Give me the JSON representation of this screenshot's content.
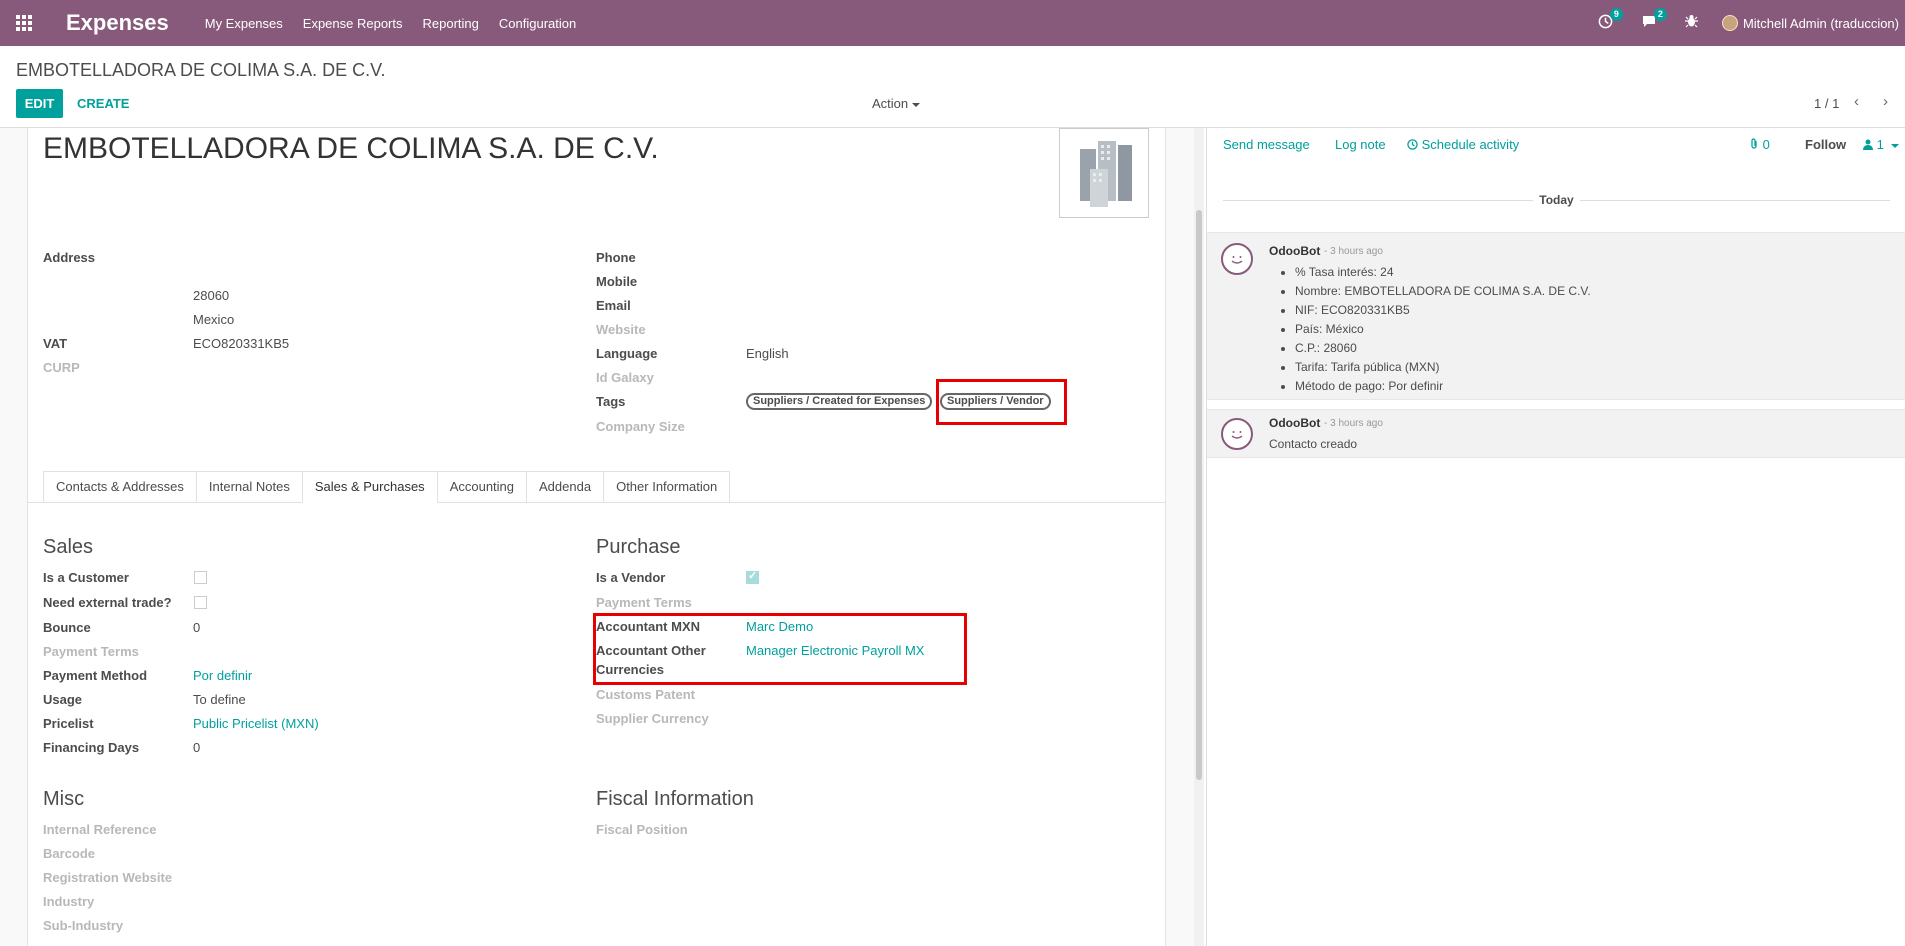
{
  "navbar": {
    "brand": "Expenses",
    "menu": [
      "My Expenses",
      "Expense Reports",
      "Reporting",
      "Configuration"
    ],
    "activity_count": "9",
    "messages_count": "2",
    "user": "Mitchell Admin (traduccion)"
  },
  "control_panel": {
    "breadcrumb": "EMBOTELLADORA DE COLIMA S.A. DE C.V.",
    "edit_label": "EDIT",
    "create_label": "CREATE",
    "action_label": "Action",
    "pager": "1 / 1"
  },
  "form": {
    "name": "EMBOTELLADORA DE COLIMA S.A. DE C.V.",
    "left": {
      "address_label": "Address",
      "zip": "28060",
      "country": "Mexico",
      "vat_label": "VAT",
      "vat": "ECO820331KB5",
      "curp_label": "CURP"
    },
    "right": {
      "phone_label": "Phone",
      "mobile_label": "Mobile",
      "email_label": "Email",
      "website_label": "Website",
      "language_label": "Language",
      "language": "English",
      "id_galaxy_label": "Id Galaxy",
      "tags_label": "Tags",
      "tags": [
        "Suppliers / Created for Expenses",
        "Suppliers / Vendor"
      ],
      "company_size_label": "Company Size"
    },
    "tabs": [
      "Contacts & Addresses",
      "Internal Notes",
      "Sales & Purchases",
      "Accounting",
      "Addenda",
      "Other Information"
    ],
    "active_tab": "Sales & Purchases",
    "sales": {
      "title": "Sales",
      "is_customer_label": "Is a Customer",
      "is_customer": false,
      "external_trade_label": "Need external trade?",
      "external_trade": false,
      "bounce_label": "Bounce",
      "bounce": "0",
      "payment_terms_label": "Payment Terms",
      "payment_method_label": "Payment Method",
      "payment_method": "Por definir",
      "usage_label": "Usage",
      "usage": "To define",
      "pricelist_label": "Pricelist",
      "pricelist": "Public Pricelist (MXN)",
      "financing_days_label": "Financing Days",
      "financing_days": "0"
    },
    "purchase": {
      "title": "Purchase",
      "is_vendor_label": "Is a Vendor",
      "is_vendor": true,
      "payment_terms_label": "Payment Terms",
      "accountant_mxn_label": "Accountant MXN",
      "accountant_mxn": "Marc Demo",
      "accountant_other_label_1": "Accountant Other",
      "accountant_other_label_2": "Currencies",
      "accountant_other": "Manager Electronic Payroll MX",
      "customs_patent_label": "Customs Patent",
      "supplier_currency_label": "Supplier Currency"
    },
    "misc": {
      "title": "Misc",
      "internal_reference_label": "Internal Reference",
      "barcode_label": "Barcode",
      "registration_website_label": "Registration Website",
      "industry_label": "Industry",
      "sub_industry_label": "Sub-Industry"
    },
    "fiscal": {
      "title": "Fiscal Information",
      "fiscal_position_label": "Fiscal Position"
    }
  },
  "chatter": {
    "send_message": "Send message",
    "log_note": "Log note",
    "schedule_activity": "Schedule activity",
    "attachments_count": "0",
    "follow": "Follow",
    "followers_count": "1",
    "today": "Today",
    "messages": [
      {
        "author": "OdooBot",
        "time": "- 3 hours ago",
        "tracking": [
          "% Tasa interés: 24",
          "Nombre: EMBOTELLADORA DE COLIMA S.A. DE C.V.",
          "NIF: ECO820331KB5",
          "País: México",
          "C.P.: 28060",
          "Tarifa: Tarifa pública (MXN)",
          "Método de pago: Por definir"
        ]
      },
      {
        "author": "OdooBot",
        "time": "- 3 hours ago",
        "body": "Contacto creado"
      }
    ]
  },
  "colors": {
    "navbar": "#875a7b",
    "accent": "#00a09d",
    "highlight_box": "#e60000"
  }
}
